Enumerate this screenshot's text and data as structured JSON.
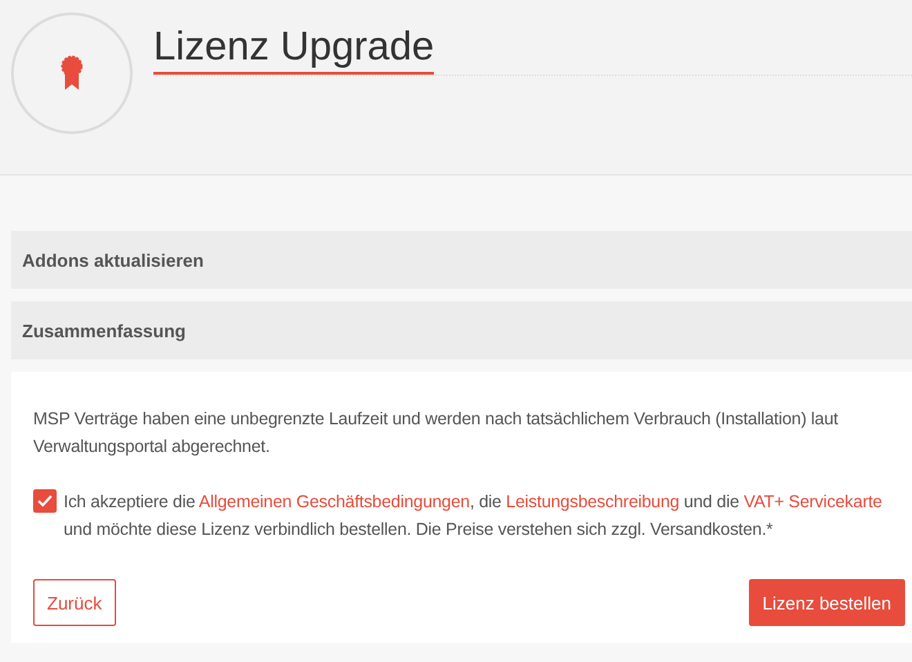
{
  "header": {
    "title": "Lizenz Upgrade"
  },
  "sections": [
    {
      "title": "Addons aktualisieren"
    },
    {
      "title": "Zusammenfassung"
    }
  ],
  "summary": {
    "info": "MSP Verträge haben eine unbegrenzte Laufzeit und werden nach tatsächlichem Verbrauch (Installation) laut Verwaltungsportal abgerechnet.",
    "agreement": {
      "checked": true,
      "parts": [
        {
          "kind": "text",
          "text": "Ich akzeptiere die "
        },
        {
          "kind": "link",
          "text": "Allgemeinen Geschäftsbedingungen"
        },
        {
          "kind": "text",
          "text": ", die "
        },
        {
          "kind": "link",
          "text": "Leistungsbeschreibung"
        },
        {
          "kind": "text",
          "text": " und die "
        },
        {
          "kind": "link",
          "text": "VAT+ Servicekarte"
        },
        {
          "kind": "text",
          "text": " und möchte diese Lizenz verbindlich bestellen. Die Preise verstehen sich zzgl. Versandkosten.*"
        }
      ]
    }
  },
  "buttons": {
    "back": "Zurück",
    "order": "Lizenz bestellen"
  }
}
